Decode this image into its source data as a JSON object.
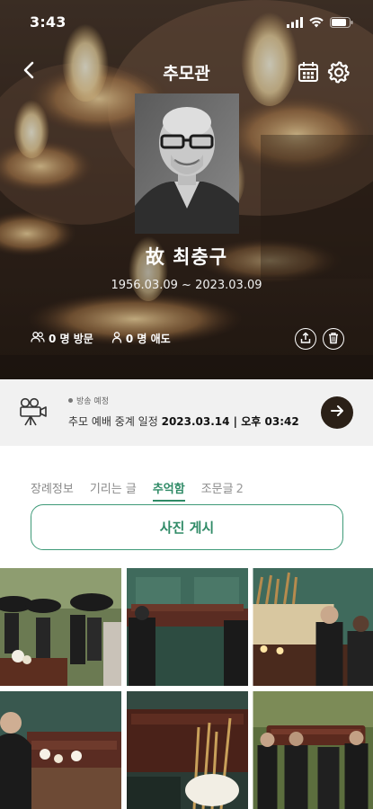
{
  "status_bar": {
    "time": "3:43"
  },
  "header": {
    "title": "추모관"
  },
  "deceased": {
    "name": "故 최충구",
    "birth_date": "1956.03.09",
    "death_date": "~ 2023.03.09"
  },
  "stats": {
    "visits": "0 명 방문",
    "mourners": "0 명 애도"
  },
  "broadcast": {
    "status": "방송 예정",
    "label": "추모 예배 중계 일정",
    "datetime": "2023.03.14 | 오후 03:42"
  },
  "tabs": [
    {
      "label": "장례정보"
    },
    {
      "label": "기리는 글"
    },
    {
      "label": "추억함",
      "active": true
    },
    {
      "label": "조문글",
      "count": "2"
    }
  ],
  "actions": {
    "post_photo_label": "사진 게시"
  },
  "colors": {
    "accent": "#2f8a66",
    "dark_button": "#2b2017",
    "broadcast_bg": "#f1f1f1"
  },
  "icons": [
    "back-arrow-icon",
    "calendar-icon",
    "gear-icon",
    "people-icon",
    "person-icon",
    "share-icon",
    "trash-icon",
    "camera-icon",
    "arrow-right-icon"
  ]
}
